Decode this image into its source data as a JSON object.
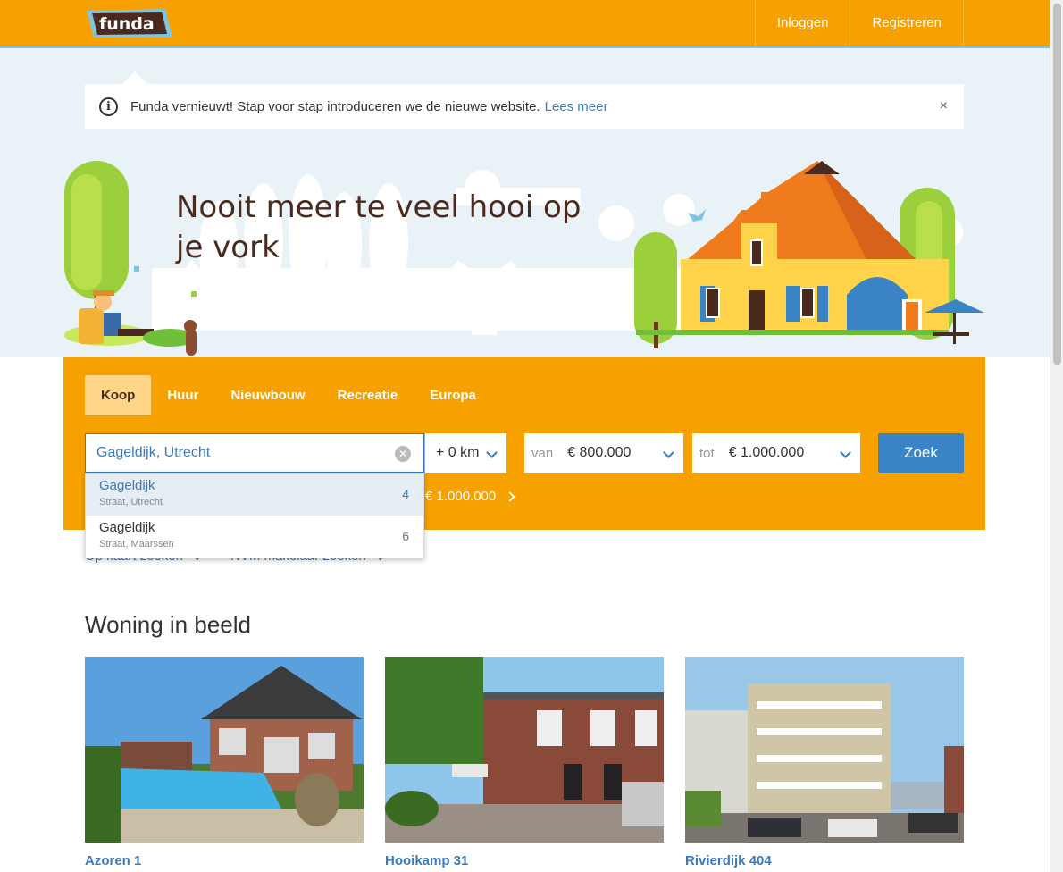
{
  "header": {
    "logo_text": "funda",
    "login": "Inloggen",
    "register": "Registreren"
  },
  "notice": {
    "text": "Funda vernieuwt! Stap voor stap introduceren we de nieuwe website.",
    "link": "Lees meer",
    "close": "×"
  },
  "hero": {
    "title": "Nooit meer te veel hooi op je vork"
  },
  "search": {
    "tabs": [
      "Koop",
      "Huur",
      "Nieuwbouw",
      "Recreatie",
      "Europa"
    ],
    "active_tab": "Koop",
    "location_value": "Gageldijk, Utrecht",
    "radius": "+ 0 km",
    "van_label": "van",
    "van_value": "€ 800.000",
    "tot_label": "tot",
    "tot_value": "€ 1.000.000",
    "submit": "Zoek",
    "last_search": "€ 1.000.000"
  },
  "suggestions": [
    {
      "name": "Gageldijk",
      "sub": "Straat, Utrecht",
      "count": "4",
      "highlight": true
    },
    {
      "name": "Gageldijk",
      "sub": "Straat, Maarssen",
      "count": "6",
      "highlight": false
    }
  ],
  "links": {
    "map": "Op kaart zoeken",
    "nvm": "NVM makelaar zoeken"
  },
  "featured": {
    "title": "Woning in beeld",
    "cards": [
      {
        "title": "Azoren 1"
      },
      {
        "title": "Hooikamp 31"
      },
      {
        "title": "Rivierdijk 404"
      }
    ]
  },
  "colors": {
    "brand_orange": "#f7a100",
    "link_blue": "#3a7bbf",
    "button_blue": "#3a83c5",
    "hero_bg": "#e9f2f7"
  }
}
